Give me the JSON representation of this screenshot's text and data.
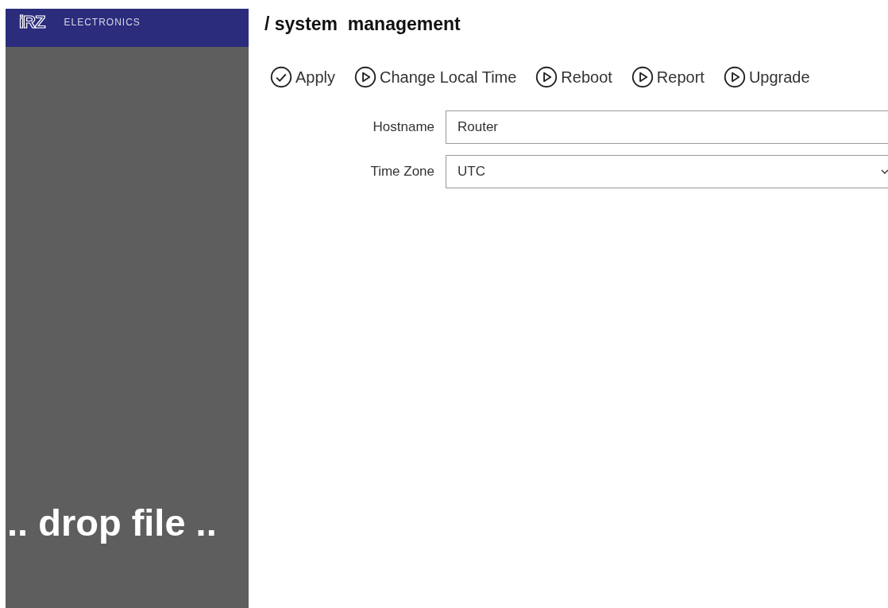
{
  "sidebar": {
    "logo": "iRZ",
    "brand": "ELECTRONICS",
    "drop_zone": ".. drop file .."
  },
  "title": "/ system  management",
  "actions": [
    {
      "label": "Apply",
      "kind": "check"
    },
    {
      "label": "Change Local Time",
      "kind": "play"
    },
    {
      "label": "Reboot",
      "kind": "play"
    },
    {
      "label": "Report",
      "kind": "play"
    },
    {
      "label": "Upgrade",
      "kind": "play"
    }
  ],
  "fields": [
    {
      "label": "Hostname",
      "value": "Router",
      "kind": "text"
    },
    {
      "label": "Time Zone",
      "value": "UTC",
      "kind": "select"
    }
  ]
}
